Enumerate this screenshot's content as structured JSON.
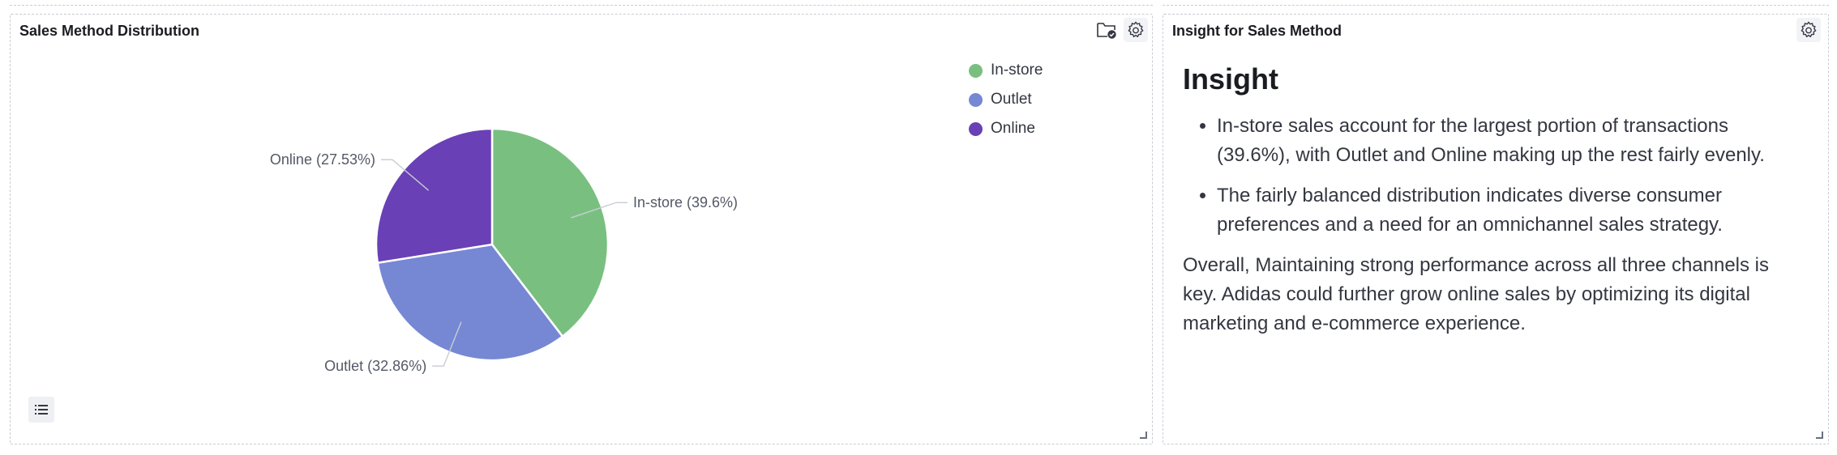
{
  "left_panel": {
    "title": "Sales Method Distribution",
    "legend": [
      {
        "label": "In-store",
        "color": "#79c080"
      },
      {
        "label": "Outlet",
        "color": "#7688d3"
      },
      {
        "label": "Online",
        "color": "#6940b5"
      }
    ]
  },
  "right_panel": {
    "title": "Insight for Sales Method",
    "heading": "Insight",
    "bullets": [
      "In-store sales account for the largest portion of transactions (39.6%), with Outlet and Online making up the rest fairly evenly.",
      "The fairly balanced distribution indicates diverse consumer preferences and a need for an omnichannel sales strategy."
    ],
    "paragraph": "Overall, Maintaining strong performance across all three channels is key. Adidas could further grow online sales by optimizing its digital marketing and e-commerce experience."
  },
  "icons": {
    "settings": "gear-icon",
    "folder": "folder-check-icon",
    "legend_toggle": "list-icon",
    "resize": "resize-handle-icon"
  },
  "chart_data": {
    "type": "pie",
    "categories": [
      "In-store",
      "Outlet",
      "Online"
    ],
    "values": [
      39.6,
      32.86,
      27.53
    ],
    "data_labels": [
      "In-store (39.6%)",
      "Outlet (32.86%)",
      "Online (27.53%)"
    ],
    "colors": [
      "#79c080",
      "#7688d3",
      "#6940b5"
    ],
    "legend_position": "top-right",
    "title": ""
  }
}
